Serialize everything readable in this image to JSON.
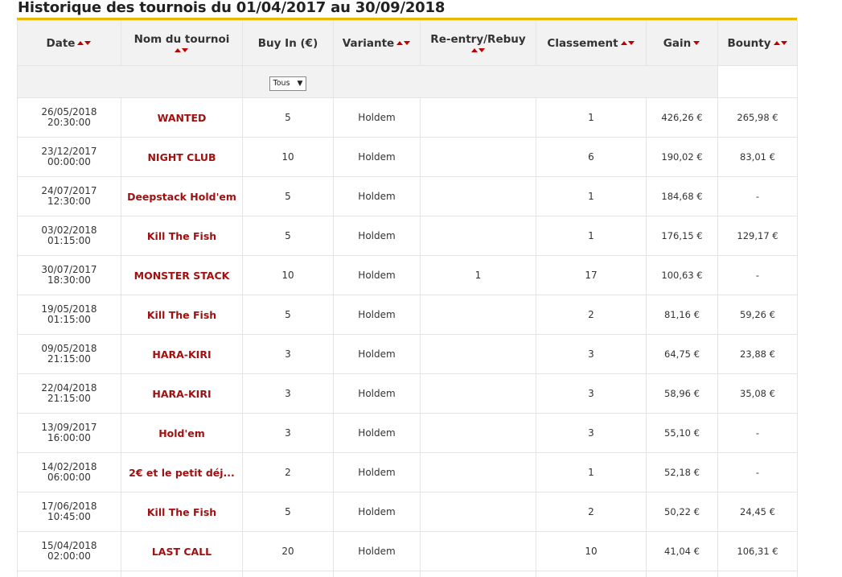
{
  "page_title": "Historique des tournois du 01/04/2017 au 30/09/2018",
  "colors": {
    "accent_bar": "#e6b800",
    "tournament_name": "#a01010",
    "sort_arrow": "#c00000",
    "header_bg": "#f2f2f2"
  },
  "columns": [
    {
      "label": "Date",
      "sort": "both"
    },
    {
      "label": "Nom du tournoi",
      "sort": "both"
    },
    {
      "label": "Buy In (€)",
      "sort": "none"
    },
    {
      "label": "Variante",
      "sort": "both"
    },
    {
      "label": "Re-entry/Rebuy",
      "sort": "both"
    },
    {
      "label": "Classement",
      "sort": "both"
    },
    {
      "label": "Gain",
      "sort": "down"
    },
    {
      "label": "Bounty",
      "sort": "both"
    }
  ],
  "filter": {
    "buyin_select": "Tous",
    "caret": "▼"
  },
  "rows": [
    {
      "date": "26/05/2018",
      "time": "20:30:00",
      "name": "WANTED",
      "buyin": "5",
      "variante": "Holdem",
      "reentry": "",
      "classement": "1",
      "gain": "426,26 €",
      "bounty": "265,98 €"
    },
    {
      "date": "23/12/2017",
      "time": "00:00:00",
      "name": "NIGHT CLUB",
      "buyin": "10",
      "variante": "Holdem",
      "reentry": "",
      "classement": "6",
      "gain": "190,02 €",
      "bounty": "83,01 €"
    },
    {
      "date": "24/07/2017",
      "time": "12:30:00",
      "name": "Deepstack Hold'em",
      "buyin": "5",
      "variante": "Holdem",
      "reentry": "",
      "classement": "1",
      "gain": "184,68 €",
      "bounty": "-"
    },
    {
      "date": "03/02/2018",
      "time": "01:15:00",
      "name": "Kill The Fish",
      "buyin": "5",
      "variante": "Holdem",
      "reentry": "",
      "classement": "1",
      "gain": "176,15 €",
      "bounty": "129,17 €"
    },
    {
      "date": "30/07/2017",
      "time": "18:30:00",
      "name": "MONSTER STACK",
      "buyin": "10",
      "variante": "Holdem",
      "reentry": "1",
      "classement": "17",
      "gain": "100,63 €",
      "bounty": "-"
    },
    {
      "date": "19/05/2018",
      "time": "01:15:00",
      "name": "Kill The Fish",
      "buyin": "5",
      "variante": "Holdem",
      "reentry": "",
      "classement": "2",
      "gain": "81,16 €",
      "bounty": "59,26 €"
    },
    {
      "date": "09/05/2018",
      "time": "21:15:00",
      "name": "HARA-KIRI",
      "buyin": "3",
      "variante": "Holdem",
      "reentry": "",
      "classement": "3",
      "gain": "64,75 €",
      "bounty": "23,88 €"
    },
    {
      "date": "22/04/2018",
      "time": "21:15:00",
      "name": "HARA-KIRI",
      "buyin": "3",
      "variante": "Holdem",
      "reentry": "",
      "classement": "3",
      "gain": "58,96 €",
      "bounty": "35,08 €"
    },
    {
      "date": "13/09/2017",
      "time": "16:00:00",
      "name": "Hold'em",
      "buyin": "3",
      "variante": "Holdem",
      "reentry": "",
      "classement": "3",
      "gain": "55,10 €",
      "bounty": "-"
    },
    {
      "date": "14/02/2018",
      "time": "06:00:00",
      "name": "2€ et le petit déj...",
      "buyin": "2",
      "variante": "Holdem",
      "reentry": "",
      "classement": "1",
      "gain": "52,18 €",
      "bounty": "-"
    },
    {
      "date": "17/06/2018",
      "time": "10:45:00",
      "name": "Kill The Fish",
      "buyin": "5",
      "variante": "Holdem",
      "reentry": "",
      "classement": "2",
      "gain": "50,22 €",
      "bounty": "24,45 €"
    },
    {
      "date": "15/04/2018",
      "time": "02:00:00",
      "name": "LAST CALL",
      "buyin": "20",
      "variante": "Holdem",
      "reentry": "",
      "classement": "10",
      "gain": "41,04 €",
      "bounty": "106,31 €"
    }
  ]
}
